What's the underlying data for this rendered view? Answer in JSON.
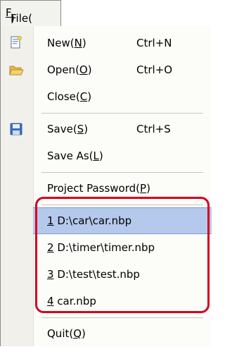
{
  "menubar": {
    "file_label": "File(F)",
    "file_label_pre": "File(",
    "file_label_key": "F",
    "file_label_post": ")"
  },
  "menu": {
    "items": [
      {
        "pre": "New(",
        "key": "N",
        "post": ")",
        "shortcut": "Ctrl+N",
        "icon": "new-document-icon"
      },
      {
        "pre": "Open(",
        "key": "O",
        "post": ")",
        "shortcut": "Ctrl+O",
        "icon": "open-folder-icon"
      },
      {
        "pre": "Close(",
        "key": "C",
        "post": ")",
        "shortcut": "",
        "icon": ""
      },
      {
        "pre": "Save(",
        "key": "S",
        "post": ")",
        "shortcut": "Ctrl+S",
        "icon": "save-disk-icon"
      },
      {
        "pre": "Save As(",
        "key": "L",
        "post": ")",
        "shortcut": "",
        "icon": ""
      },
      {
        "pre": "Project Password(",
        "key": "P",
        "post": ")",
        "shortcut": "",
        "icon": ""
      }
    ],
    "recent": [
      {
        "key": "1",
        "text": " D:\\car\\car.nbp"
      },
      {
        "key": "2",
        "text": " D:\\timer\\timer.nbp"
      },
      {
        "key": "3",
        "text": " D:\\test\\test.nbp"
      },
      {
        "key": "4",
        "text": " car.nbp"
      }
    ],
    "quit": {
      "pre": "Quit(",
      "key": "Q",
      "post": ")"
    }
  },
  "colors": {
    "highlight": "#b5c9ec",
    "callout_border": "#d6001c",
    "gutter": "#f1f0ea"
  }
}
